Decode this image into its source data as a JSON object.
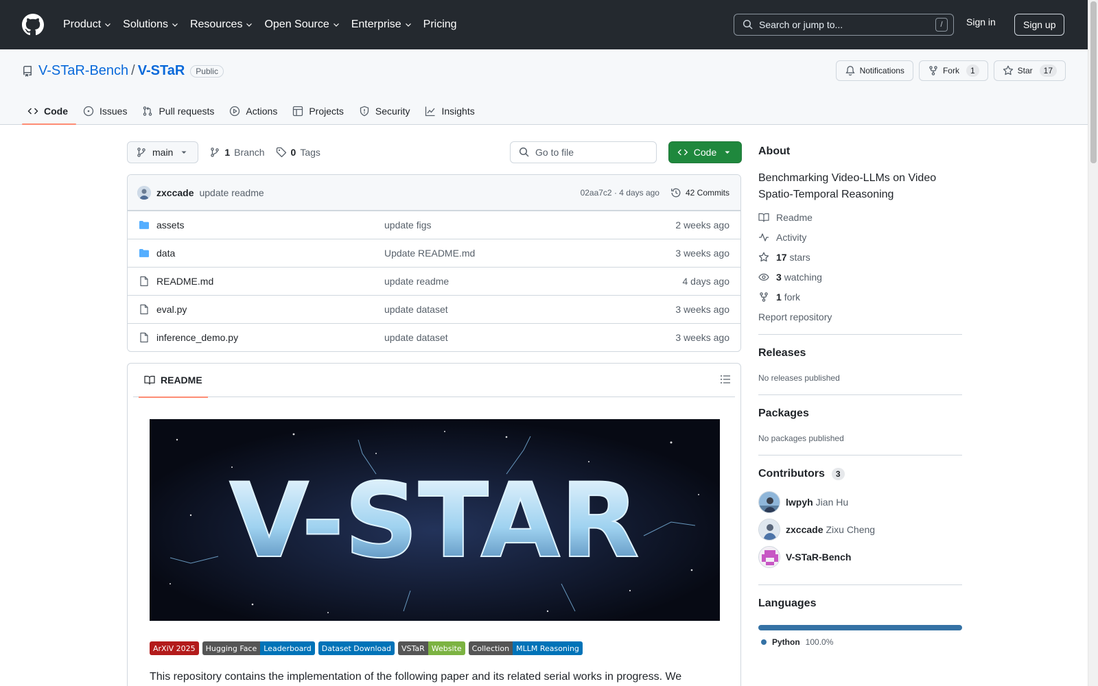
{
  "header": {
    "nav": [
      "Product",
      "Solutions",
      "Resources",
      "Open Source",
      "Enterprise",
      "Pricing"
    ],
    "search_placeholder": "Search or jump to...",
    "slash_key": "/",
    "sign_in": "Sign in",
    "sign_up": "Sign up"
  },
  "repo": {
    "owner": "V-STaR-Bench",
    "separator": "/",
    "name": "V-STaR",
    "visibility": "Public",
    "notifications_label": "Notifications",
    "fork_label": "Fork",
    "fork_count": "1",
    "star_label": "Star",
    "star_count": "17",
    "tabs": [
      "Code",
      "Issues",
      "Pull requests",
      "Actions",
      "Projects",
      "Security",
      "Insights"
    ]
  },
  "file_nav": {
    "branch": "main",
    "branch_count": "1",
    "branch_label": "Branch",
    "tag_count": "0",
    "tag_label": "Tags",
    "goto_placeholder": "Go to file",
    "code_button": "Code"
  },
  "commit": {
    "author": "zxccade",
    "message": "update readme",
    "meta": "02aa7c2 · 4 days ago",
    "commits_label": "42 Commits"
  },
  "files": [
    {
      "name": "assets",
      "type": "folder",
      "commit": "update figs",
      "age": "2 weeks ago"
    },
    {
      "name": "data",
      "type": "folder",
      "commit": "Update README.md",
      "age": "3 weeks ago"
    },
    {
      "name": "README.md",
      "type": "file",
      "commit": "update readme",
      "age": "4 days ago"
    },
    {
      "name": "eval.py",
      "type": "file",
      "commit": "update dataset",
      "age": "3 weeks ago"
    },
    {
      "name": "inference_demo.py",
      "type": "file",
      "commit": "update dataset",
      "age": "3 weeks ago"
    }
  ],
  "readme": {
    "tab_label": "README",
    "banner_text": "V-STAR",
    "badges": [
      {
        "left": "ArXiV 2025",
        "right": "",
        "left_color": "#b31b1b",
        "right_color": ""
      },
      {
        "left": "Hugging Face",
        "right": "Leaderboard",
        "left_color": "#555555",
        "right_color": "#0073b8"
      },
      {
        "left": "Dataset Download",
        "right": "",
        "left_color": "#0073b8",
        "right_color": ""
      },
      {
        "left": "VSTaR",
        "right": "Website",
        "left_color": "#555555",
        "right_color": "#7cb342"
      },
      {
        "left": "Collection",
        "right": "MLLM Reasoning",
        "left_color": "#555555",
        "right_color": "#0073b8"
      }
    ],
    "paragraph": "This repository contains the implementation of the following paper and its related serial works in progress. We"
  },
  "about": {
    "title": "About",
    "description": "Benchmarking Video-LLMs on Video Spatio-Temporal Reasoning",
    "readme": "Readme",
    "activity": "Activity",
    "stars_count": "17",
    "stars_label": "stars",
    "watching_count": "3",
    "watching_label": "watching",
    "fork_count": "1",
    "fork_label": "fork",
    "report": "Report repository"
  },
  "releases": {
    "title": "Releases",
    "text": "No releases published"
  },
  "packages": {
    "title": "Packages",
    "text": "No packages published"
  },
  "contributors": {
    "title": "Contributors",
    "count": "3",
    "list": [
      {
        "login": "lwpyh",
        "name": "Jian Hu"
      },
      {
        "login": "zxccade",
        "name": "Zixu Cheng"
      },
      {
        "login": "V-STaR-Bench",
        "name": ""
      }
    ]
  },
  "languages": {
    "title": "Languages",
    "items": [
      {
        "name": "Python",
        "percent": "100.0%",
        "color": "#3572a5"
      }
    ]
  }
}
